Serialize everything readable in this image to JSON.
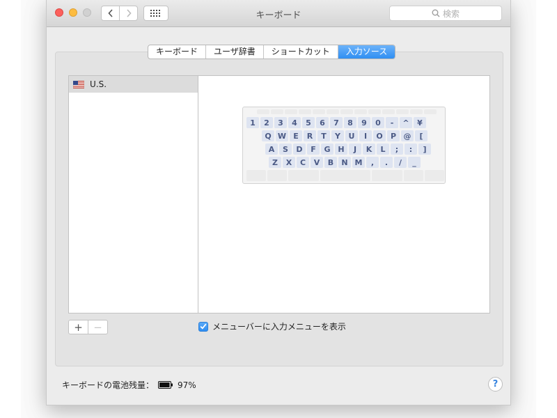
{
  "window": {
    "title": "キーボード"
  },
  "toolbar": {
    "search_placeholder": "検索"
  },
  "tabs": [
    {
      "label": "キーボード",
      "active": false
    },
    {
      "label": "ユーザ辞書",
      "active": false
    },
    {
      "label": "ショートカット",
      "active": false
    },
    {
      "label": "入力ソース",
      "active": true
    }
  ],
  "input_sources": [
    {
      "label": "U.S.",
      "selected": true
    }
  ],
  "keyboard_rows": [
    [
      "1",
      "2",
      "3",
      "4",
      "5",
      "6",
      "7",
      "8",
      "9",
      "0",
      "-",
      "^",
      "¥"
    ],
    [
      "Q",
      "W",
      "E",
      "R",
      "T",
      "Y",
      "U",
      "I",
      "O",
      "P",
      "@",
      "["
    ],
    [
      "A",
      "S",
      "D",
      "F",
      "G",
      "H",
      "J",
      "K",
      "L",
      ";",
      ":",
      "]"
    ],
    [
      "Z",
      "X",
      "C",
      "V",
      "B",
      "N",
      "M",
      ",",
      ".",
      "/",
      "_"
    ]
  ],
  "buttons": {
    "add": "+",
    "remove": "−"
  },
  "show_menu_checkbox": {
    "label": "メニューバーに入力メニューを表示",
    "checked": true
  },
  "battery": {
    "label": "キーボードの電池残量：",
    "percent": "97%",
    "level": 0.97
  },
  "help": "?",
  "colors": {
    "accent": "#2f8ef2",
    "key_fill": "#dee4f1",
    "key_text": "#4b5a85"
  }
}
